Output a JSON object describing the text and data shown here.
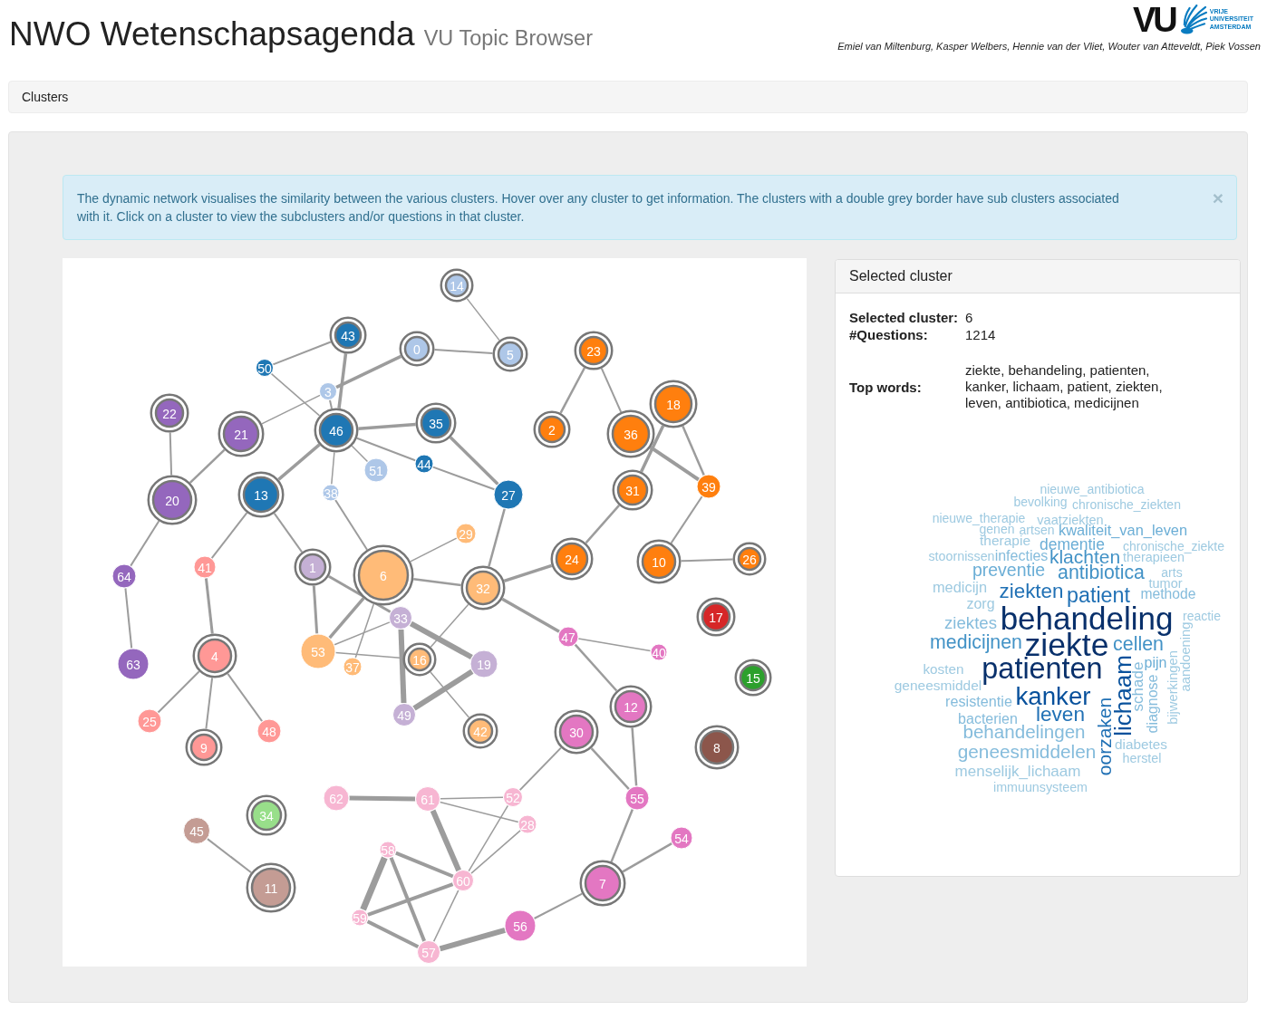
{
  "header": {
    "title": "NWO Wetenschapsagenda",
    "subtitle": "VU Topic Browser",
    "logo": {
      "mark": "VU",
      "wordmark": "VRIJE UNIVERSITEIT AMSTERDAM"
    },
    "authors": "Emiel van Miltenburg, Kasper Welbers, Hennie van der Vliet, Wouter van Atteveldt, Piek Vossen"
  },
  "breadcrumb": {
    "label": "Clusters"
  },
  "alert": {
    "message": "The dynamic network visualises the similarity between the various clusters. Hover over any cluster to get information. The clusters with a double grey border have sub clusters associated with it. Click on a cluster to view the subclusters and/or questions in that cluster.",
    "close": "×"
  },
  "network": {
    "clusters": [
      {
        "label": "14",
        "color": "#aec7e8",
        "has_subclusters": true
      },
      {
        "label": "50",
        "color": "#1f77b4",
        "has_subclusters": false
      },
      {
        "label": "43",
        "color": "#1f77b4",
        "has_subclusters": true
      },
      {
        "label": "0",
        "color": "#aec7e8",
        "has_subclusters": true
      },
      {
        "label": "5",
        "color": "#aec7e8",
        "has_subclusters": true
      },
      {
        "label": "23",
        "color": "#ff7f0e",
        "has_subclusters": true
      },
      {
        "label": "3",
        "color": "#aec7e8",
        "has_subclusters": false
      },
      {
        "label": "22",
        "color": "#9467bd",
        "has_subclusters": true
      },
      {
        "label": "21",
        "color": "#9467bd",
        "has_subclusters": true
      },
      {
        "label": "46",
        "color": "#1f77b4",
        "has_subclusters": true
      },
      {
        "label": "35",
        "color": "#1f77b4",
        "has_subclusters": true
      },
      {
        "label": "2",
        "color": "#ff7f0e",
        "has_subclusters": true
      },
      {
        "label": "36",
        "color": "#ff7f0e",
        "has_subclusters": true
      },
      {
        "label": "18",
        "color": "#ff7f0e",
        "has_subclusters": true
      },
      {
        "label": "51",
        "color": "#aec7e8",
        "has_subclusters": false
      },
      {
        "label": "44",
        "color": "#1f77b4",
        "has_subclusters": false
      },
      {
        "label": "20",
        "color": "#9467bd",
        "has_subclusters": true
      },
      {
        "label": "13",
        "color": "#1f77b4",
        "has_subclusters": true
      },
      {
        "label": "38",
        "color": "#aec7e8",
        "has_subclusters": false
      },
      {
        "label": "27",
        "color": "#1f77b4",
        "has_subclusters": false
      },
      {
        "label": "31",
        "color": "#ff7f0e",
        "has_subclusters": true
      },
      {
        "label": "39",
        "color": "#ff7f0e",
        "has_subclusters": false
      },
      {
        "label": "29",
        "color": "#ffbb78",
        "has_subclusters": false
      },
      {
        "label": "64",
        "color": "#9467bd",
        "has_subclusters": false
      },
      {
        "label": "41",
        "color": "#ff9896",
        "has_subclusters": false
      },
      {
        "label": "1",
        "color": "#c5b0d5",
        "has_subclusters": true
      },
      {
        "label": "6",
        "color": "#ffbb78",
        "has_subclusters": true
      },
      {
        "label": "32",
        "color": "#ffbb78",
        "has_subclusters": true
      },
      {
        "label": "24",
        "color": "#ff7f0e",
        "has_subclusters": true
      },
      {
        "label": "10",
        "color": "#ff7f0e",
        "has_subclusters": true
      },
      {
        "label": "26",
        "color": "#ff7f0e",
        "has_subclusters": true
      },
      {
        "label": "33",
        "color": "#c5b0d5",
        "has_subclusters": false
      },
      {
        "label": "47",
        "color": "#e377c2",
        "has_subclusters": false
      },
      {
        "label": "17",
        "color": "#d62728",
        "has_subclusters": true
      },
      {
        "label": "63",
        "color": "#9467bd",
        "has_subclusters": false
      },
      {
        "label": "4",
        "color": "#ff9896",
        "has_subclusters": true
      },
      {
        "label": "53",
        "color": "#ffbb78",
        "has_subclusters": false
      },
      {
        "label": "37",
        "color": "#ffbb78",
        "has_subclusters": false
      },
      {
        "label": "16",
        "color": "#ffbb78",
        "has_subclusters": true
      },
      {
        "label": "19",
        "color": "#c5b0d5",
        "has_subclusters": false
      },
      {
        "label": "40",
        "color": "#e377c2",
        "has_subclusters": false
      },
      {
        "label": "15",
        "color": "#2ca02c",
        "has_subclusters": true
      },
      {
        "label": "25",
        "color": "#ff9896",
        "has_subclusters": false
      },
      {
        "label": "9",
        "color": "#ff9896",
        "has_subclusters": true
      },
      {
        "label": "48",
        "color": "#ff9896",
        "has_subclusters": false
      },
      {
        "label": "49",
        "color": "#c5b0d5",
        "has_subclusters": false
      },
      {
        "label": "42",
        "color": "#ffbb78",
        "has_subclusters": true
      },
      {
        "label": "30",
        "color": "#e377c2",
        "has_subclusters": true
      },
      {
        "label": "12",
        "color": "#e377c2",
        "has_subclusters": true
      },
      {
        "label": "8",
        "color": "#8c564b",
        "has_subclusters": true
      },
      {
        "label": "34",
        "color": "#98df8a",
        "has_subclusters": true
      },
      {
        "label": "62",
        "color": "#f7b6d2",
        "has_subclusters": false
      },
      {
        "label": "61",
        "color": "#f7b6d2",
        "has_subclusters": false
      },
      {
        "label": "52",
        "color": "#f7b6d2",
        "has_subclusters": false
      },
      {
        "label": "55",
        "color": "#e377c2",
        "has_subclusters": false
      },
      {
        "label": "45",
        "color": "#c49c94",
        "has_subclusters": false
      },
      {
        "label": "28",
        "color": "#f7b6d2",
        "has_subclusters": false
      },
      {
        "label": "58",
        "color": "#f7b6d2",
        "has_subclusters": false
      },
      {
        "label": "54",
        "color": "#e377c2",
        "has_subclusters": false
      },
      {
        "label": "11",
        "color": "#c49c94",
        "has_subclusters": true
      },
      {
        "label": "60",
        "color": "#f7b6d2",
        "has_subclusters": false
      },
      {
        "label": "7",
        "color": "#e377c2",
        "has_subclusters": true
      },
      {
        "label": "59",
        "color": "#f7b6d2",
        "has_subclusters": false
      },
      {
        "label": "56",
        "color": "#e377c2",
        "has_subclusters": false
      },
      {
        "label": "57",
        "color": "#f7b6d2",
        "has_subclusters": false
      }
    ]
  },
  "selected_cluster": {
    "title": "Selected cluster",
    "fields": [
      {
        "label": "Selected cluster:",
        "value": "6"
      },
      {
        "label": "#Questions:",
        "value": "1214"
      },
      {
        "label": "Top words:",
        "value": "ziekte, behandeling, patienten, kanker, lichaam, patient, ziekten, leven, antibiotica, medicijnen"
      }
    ],
    "word_cloud": [
      {
        "word": "nieuwe_antibiotica",
        "color": "#9ecae1"
      },
      {
        "word": "bevolking",
        "color": "#9ecae1"
      },
      {
        "word": "chronische_ziekten",
        "color": "#9ecae1"
      },
      {
        "word": "nieuwe_therapie",
        "color": "#9ecae1"
      },
      {
        "word": "vaatziekten",
        "color": "#9ecae1"
      },
      {
        "word": "genen",
        "color": "#9ecae1"
      },
      {
        "word": "artsen",
        "color": "#9ecae1"
      },
      {
        "word": "kwaliteit_van_leven",
        "color": "#6baed6"
      },
      {
        "word": "therapie",
        "color": "#9ecae1"
      },
      {
        "word": "dementie",
        "color": "#6baed6"
      },
      {
        "word": "chronische_ziekte",
        "color": "#9ecae1"
      },
      {
        "word": "stoornissen",
        "color": "#9ecae1"
      },
      {
        "word": "infecties",
        "color": "#85bcdc"
      },
      {
        "word": "klachten",
        "color": "#4292c6"
      },
      {
        "word": "therapieen",
        "color": "#9ecae1"
      },
      {
        "word": "preventie",
        "color": "#6baed6"
      },
      {
        "word": "antibiotica",
        "color": "#4292c6"
      },
      {
        "word": "arts",
        "color": "#9ecae1"
      },
      {
        "word": "medicijn",
        "color": "#9ecae1"
      },
      {
        "word": "zorg",
        "color": "#9ecae1"
      },
      {
        "word": "ziekten",
        "color": "#2171b5"
      },
      {
        "word": "patient",
        "color": "#2171b5"
      },
      {
        "word": "tumor",
        "color": "#9ecae1"
      },
      {
        "word": "methode",
        "color": "#85bcdc"
      },
      {
        "word": "ziektes",
        "color": "#85bcdc"
      },
      {
        "word": "behandeling",
        "color": "#08306b"
      },
      {
        "word": "reactie",
        "color": "#9ecae1"
      },
      {
        "word": "medicijnen",
        "color": "#4292c6"
      },
      {
        "word": "ziekte",
        "color": "#08306b"
      },
      {
        "word": "cellen",
        "color": "#4292c6"
      },
      {
        "word": "kosten",
        "color": "#9ecae1"
      },
      {
        "word": "patienten",
        "color": "#08306b"
      },
      {
        "word": "pijn",
        "color": "#6baed6"
      },
      {
        "word": "geneesmiddel",
        "color": "#9ecae1"
      },
      {
        "word": "resistentie",
        "color": "#85bcdc"
      },
      {
        "word": "kanker",
        "color": "#08519c"
      },
      {
        "word": "bacterien",
        "color": "#85bcdc"
      },
      {
        "word": "leven",
        "color": "#2171b5"
      },
      {
        "word": "lichaam",
        "color": "#08519c"
      },
      {
        "word": "schade",
        "color": "#85bcdc"
      },
      {
        "word": "diagnose",
        "color": "#85bcdc"
      },
      {
        "word": "bijwerkingen",
        "color": "#9ecae1"
      },
      {
        "word": "aandoening",
        "color": "#9ecae1"
      },
      {
        "word": "behandelingen",
        "color": "#85bcdc"
      },
      {
        "word": "geneesmiddelen",
        "color": "#85bcdc"
      },
      {
        "word": "menselijk_lichaam",
        "color": "#9ecae1"
      },
      {
        "word": "oorzaken",
        "color": "#2171b5"
      },
      {
        "word": "diabetes",
        "color": "#9ecae1"
      },
      {
        "word": "herstel",
        "color": "#9ecae1"
      },
      {
        "word": "immuunsysteem",
        "color": "#9ecae1"
      }
    ]
  }
}
